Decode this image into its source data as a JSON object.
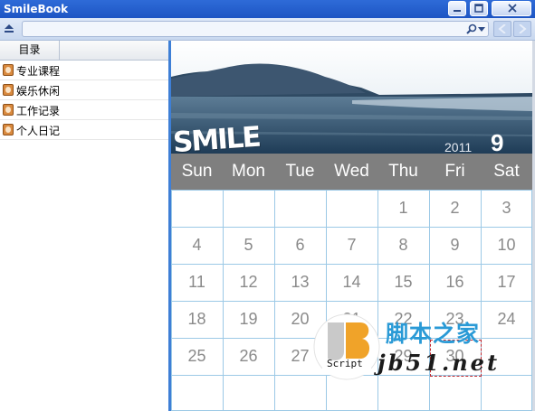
{
  "window": {
    "title": "SmileBook"
  },
  "sidebar": {
    "column_header": "目录",
    "items": [
      {
        "label": "专业课程",
        "icon": "book-icon"
      },
      {
        "label": "娱乐休闲",
        "icon": "book-icon"
      },
      {
        "label": "工作记录",
        "icon": "book-icon"
      },
      {
        "label": "个人日记",
        "icon": "book-icon"
      }
    ]
  },
  "calendar": {
    "logo_text": "SMILE",
    "year": "2011",
    "month": "9",
    "weekdays": [
      "Sun",
      "Mon",
      "Tue",
      "Wed",
      "Thu",
      "Fri",
      "Sat"
    ],
    "weeks": [
      [
        "",
        "",
        "",
        "",
        "1",
        "2",
        "3"
      ],
      [
        "4",
        "5",
        "6",
        "7",
        "8",
        "9",
        "10"
      ],
      [
        "11",
        "12",
        "13",
        "14",
        "15",
        "16",
        "17"
      ],
      [
        "18",
        "19",
        "20",
        "21",
        "22",
        "23",
        "24"
      ],
      [
        "25",
        "26",
        "27",
        "28",
        "29",
        "30",
        ""
      ],
      [
        "",
        "",
        "",
        "",
        "",
        "",
        ""
      ]
    ],
    "header_color": "#7f7f7f",
    "grid_color": "#9cc9e6",
    "selected_day": "30"
  },
  "watermark": {
    "seal_text": "Script",
    "cn_text": "脚本之家",
    "url_text": "jb51.net"
  },
  "colors": {
    "titlebar": "#2563d0",
    "accent": "#3e7fd6"
  }
}
